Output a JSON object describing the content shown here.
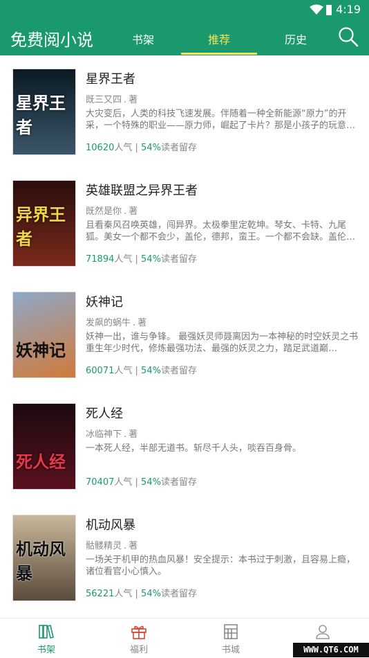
{
  "status": {
    "time": "4:19"
  },
  "header": {
    "title": "免费阅小说",
    "tabs": [
      {
        "label": "书架",
        "active": false
      },
      {
        "label": "推荐",
        "active": true
      },
      {
        "label": "历史",
        "active": false
      }
    ]
  },
  "books": [
    {
      "title": "星界王者",
      "author": "既三又四",
      "by": "著",
      "desc": "大灾变后，人类的科技飞速发展。伴随着一种全新能源“原力”的开采，一个特殊的职业——原力师，崛起了卡片？那是小孩子的玩意…",
      "popularity": "10620",
      "popularity_label": "人气",
      "sep": "|",
      "retention": "54%",
      "retention_label": "读者留存",
      "cover_text": "星界王者",
      "cover_colors": [
        "#0b1a24",
        "#3a566a"
      ]
    },
    {
      "title": "英雄联盟之异界王者",
      "author": "既然是你",
      "by": "著",
      "desc": "且看秦风召唤英雄，闯异界。太极拳里定乾坤。琴女、卡特、九尾狐。美女一个都不会少，盖伦，德邦，蛮王。一个都不会缺。盖伦…",
      "popularity": "71894",
      "popularity_label": "人气",
      "sep": "|",
      "retention": "54%",
      "retention_label": "读者留存",
      "cover_text": "异界王者",
      "cover_colors": [
        "#2a0d0d",
        "#7a2a1a"
      ]
    },
    {
      "title": "妖神记",
      "author": "发飙的蜗牛",
      "by": "著",
      "desc": "妖神一出，谁与争锋。 最强妖灵师聂离因为一本神秘的时空妖灵之书重生年少时代，修炼最强功法、最强的妖灵之力，踏足武道巅…",
      "popularity": "60071",
      "popularity_label": "人气",
      "sep": "|",
      "retention": "54%",
      "retention_label": "读者留存",
      "cover_text": "妖神记",
      "cover_colors": [
        "#8fa8c8",
        "#d07a3a"
      ]
    },
    {
      "title": "死人经",
      "author": "冰临神下",
      "by": "著",
      "desc": "一本死人经，半部无道书。斩尽千人头，啖吞百身骨。",
      "popularity": "70407",
      "popularity_label": "人气",
      "sep": "|",
      "retention": "54%",
      "retention_label": "读者留存",
      "cover_text": "死人经",
      "cover_colors": [
        "#1a0a0e",
        "#5a1020"
      ]
    },
    {
      "title": "机动风暴",
      "author": "骷髅精灵",
      "by": "著",
      "desc": "一场关于机甲的热血风暴！安全提示：本书过于刺激，且容易上瘾，诸位看官小心慎入。",
      "popularity": "56221",
      "popularity_label": "人气",
      "sep": "|",
      "retention": "54%",
      "retention_label": "读者留存",
      "cover_text": "机动风暴",
      "cover_colors": [
        "#c9b79a",
        "#5a4a3a"
      ]
    }
  ],
  "bottom_nav": [
    {
      "label": "书架",
      "active": true
    },
    {
      "label": "福利",
      "active": false
    },
    {
      "label": "书城",
      "active": false
    },
    {
      "label": "",
      "active": false
    }
  ],
  "watermark": "WWW.QT6.COM",
  "colors": {
    "primary": "#1a9a6c",
    "accent": "#f4e15d",
    "gift": "#d9432f"
  }
}
